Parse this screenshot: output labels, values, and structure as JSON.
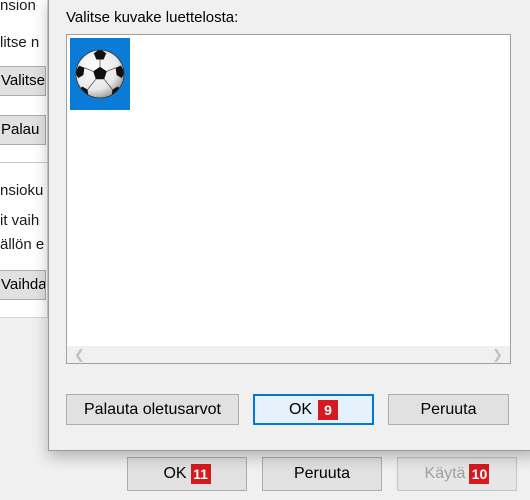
{
  "background_dialog": {
    "line1": "nsion",
    "line2": "litse n",
    "button1": "Valitse",
    "button2": "Palau",
    "line3": "nsioku",
    "line4": "it vaih",
    "line5": "ällön e",
    "button3": "Vaihda"
  },
  "bottom_buttons": {
    "ok_label": "OK",
    "ok_badge": "11",
    "cancel_label": "Peruuta",
    "apply_label": "Käytä",
    "apply_badge": "10"
  },
  "icon_dialog": {
    "label": "Valitse kuvake luettelosta:",
    "icons": [
      {
        "icon": "soccer-ball-icon",
        "selected": true
      }
    ],
    "restore_defaults_label": "Palauta oletusarvot",
    "ok_label": "OK",
    "ok_badge": "9",
    "cancel_label": "Peruuta"
  },
  "colors": {
    "selection": "#0a7bd6",
    "badge": "#d71920",
    "default_button_border": "#0078d7"
  }
}
